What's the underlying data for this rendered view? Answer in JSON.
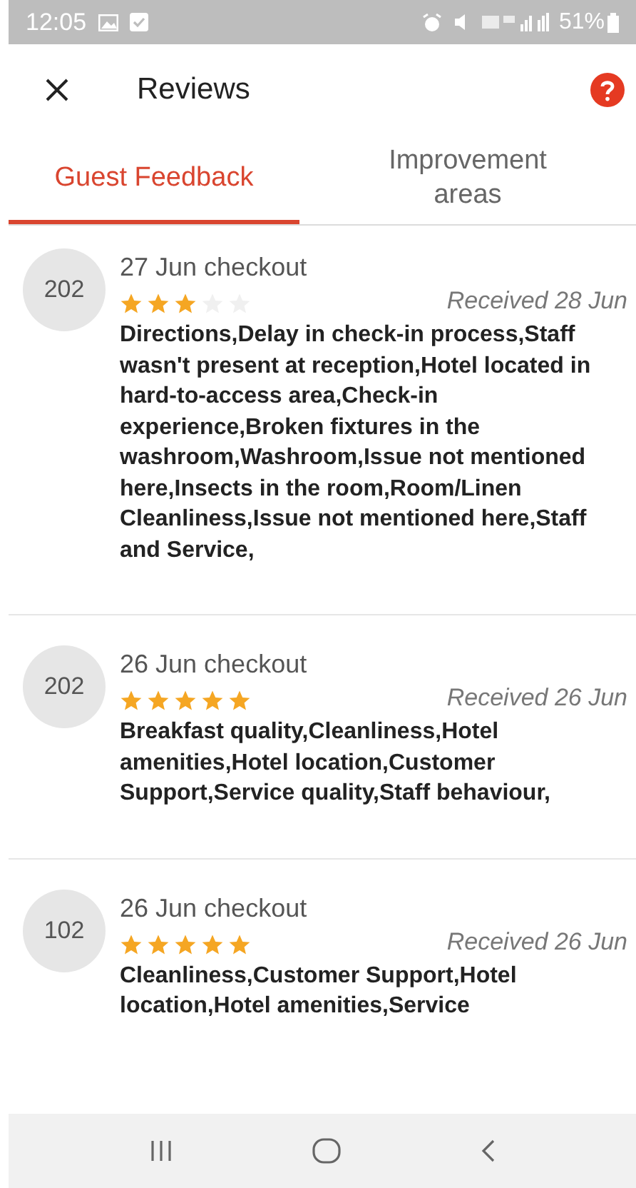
{
  "status_bar": {
    "time": "12:05",
    "battery": "51%"
  },
  "header": {
    "title": "Reviews"
  },
  "tabs": [
    {
      "label": "Guest Feedback",
      "selected": true
    },
    {
      "label": "Improvement areas",
      "selected": false
    }
  ],
  "reviews": [
    {
      "room": "202",
      "checkout": "27 Jun checkout",
      "stars": 3,
      "received": "Received 28 Jun",
      "feedback": "Directions,Delay in check-in process,Staff wasn't present at reception,Hotel located in hard-to-access area,Check-in experience,Broken fixtures in the washroom,Washroom,Issue not mentioned here,Insects in the room,Room/Linen Cleanliness,Issue not mentioned here,Staff and Service,"
    },
    {
      "room": "202",
      "checkout": "26 Jun checkout",
      "stars": 5,
      "received": "Received 26 Jun",
      "feedback": "Breakfast quality,Cleanliness,Hotel amenities,Hotel location,Customer Support,Service quality,Staff behaviour,"
    },
    {
      "room": "102",
      "checkout": "26 Jun checkout",
      "stars": 5,
      "received": "Received 26 Jun",
      "feedback": "Cleanliness,Customer Support,Hotel location,Hotel amenities,Service"
    }
  ]
}
